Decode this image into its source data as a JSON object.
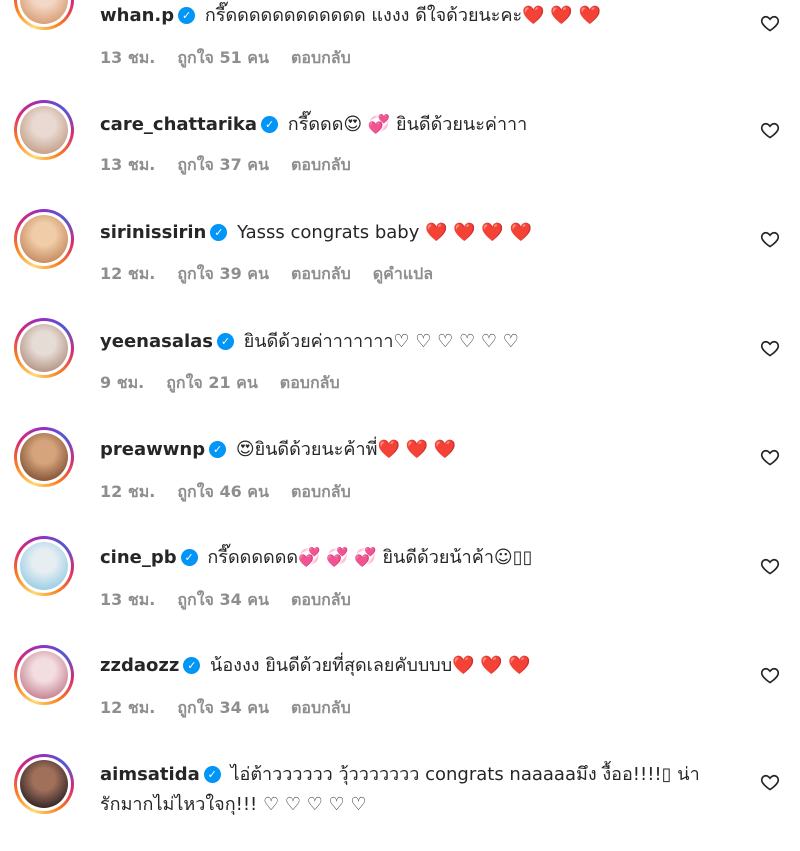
{
  "comments": [
    {
      "user": "whan.p",
      "text": "กรี๊ดดดดดดดดดดดด แงงง ดีใจด้วยนะคะ❤️ ❤️ ❤️",
      "time": "13 ชม.",
      "likes": "ถูกใจ 51 คน",
      "reply": "ตอบกลับ",
      "translate": "",
      "colors": [
        "#d9a27a",
        "#f3d7c5"
      ]
    },
    {
      "user": "care_chattarika",
      "text": "กรี๊ดดด😍 💞  ยินดีด้วยนะค่าาา",
      "time": "13 ชม.",
      "likes": "ถูกใจ 37 คน",
      "reply": "ตอบกลับ",
      "translate": "",
      "colors": [
        "#e9d9d2",
        "#c7a48e"
      ]
    },
    {
      "user": "sirinissirin",
      "text": "Yasss congrats baby ❤️ ❤️ ❤️ ❤️",
      "time": "12 ชม.",
      "likes": "ถูกใจ 39 คน",
      "reply": "ตอบกลับ",
      "translate": "ดูคำแปล",
      "colors": [
        "#c98f64",
        "#f0cda8"
      ]
    },
    {
      "user": "yeenasalas",
      "text": "ยินดีด้วยค่าาาาาาา♡ ♡ ♡ ♡ ♡ ♡",
      "time": "9 ชม.",
      "likes": "ถูกใจ 21 คน",
      "reply": "ตอบกลับ",
      "translate": "",
      "colors": [
        "#e6dcd6",
        "#b89a8a"
      ]
    },
    {
      "user": "preawwnp",
      "text": "😍ยินดีด้วยนะค้าพี่❤️ ❤️ ❤️",
      "time": "12 ชม.",
      "likes": "ถูกใจ 46 คน",
      "reply": "ตอบกลับ",
      "translate": "",
      "colors": [
        "#8a5a3c",
        "#d6a47c"
      ]
    },
    {
      "user": "cine_pb",
      "text": "กรี๊ดดดดดด💞 💞 💞  ยินดีด้วยน้าค้า☺︎▯▯",
      "time": "13 ชม.",
      "likes": "ถูกใจ 34 คน",
      "reply": "ตอบกลับ",
      "translate": "",
      "colors": [
        "#9fd0e6",
        "#e7eef2"
      ]
    },
    {
      "user": "zzdaozz",
      "text": "น้องงง ยินดีด้วยที่สุดเลยคับบบบ❤️ ❤️ ❤️",
      "time": "12 ชม.",
      "likes": "ถูกใจ 34 คน",
      "reply": "ตอบกลับ",
      "translate": "",
      "colors": [
        "#c98a98",
        "#f2dde1"
      ]
    },
    {
      "user": "aimsatida",
      "text": "ไอ่ต้าวววววว วุ้ววววววว congrats naaaaaมึง งื้ออ!!!!▯ น่ารักมากไม่ไหวใจกุ!!! ♡ ♡ ♡ ♡ ♡",
      "time": "",
      "likes": "",
      "reply": "",
      "translate": "",
      "colors": [
        "#3a2a2a",
        "#a0705a"
      ]
    }
  ],
  "icons": {
    "verified": "verified-badge-icon",
    "like": "heart-outline-icon"
  },
  "accent": "#0095f6"
}
